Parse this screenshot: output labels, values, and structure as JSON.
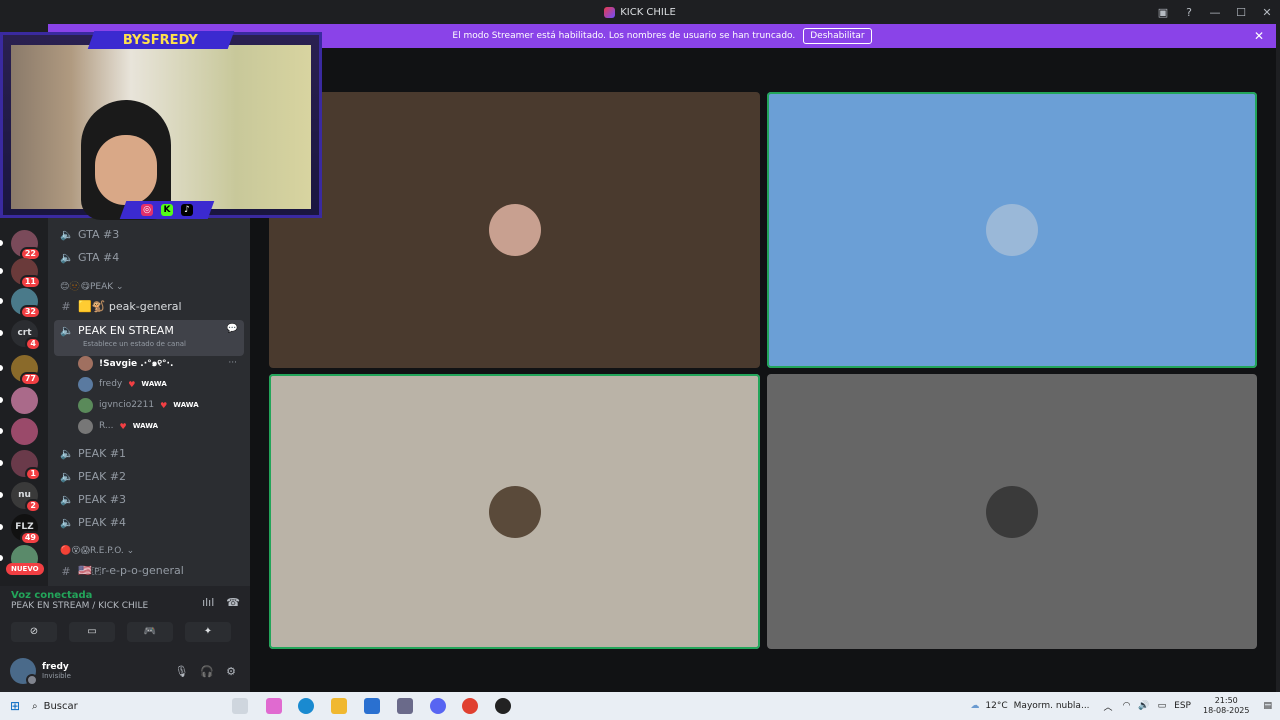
{
  "window": {
    "title": "KICK CHILE",
    "controls": [
      "inbox-icon",
      "help-icon",
      "minimize-icon",
      "maximize-icon",
      "close-icon"
    ]
  },
  "banner": {
    "text": "El modo Streamer está habilitado. Los nombres de usuario se han truncado.",
    "button": "Deshabilitar"
  },
  "overlay": {
    "name": "BYSFREDY",
    "socials": [
      "instagram-icon",
      "kick-icon",
      "tiktok-icon"
    ],
    "social_labels": [
      "◎",
      "K",
      "♪"
    ]
  },
  "servers": [
    {
      "badge": "22",
      "color": "#7a4a5a"
    },
    {
      "badge": "11",
      "color": "#6a3a3a"
    },
    {
      "badge": "32",
      "color": "#4a7a8a"
    },
    {
      "badge": "4",
      "label": "crt",
      "color": "#2b2d31"
    },
    {
      "badge": "77",
      "color": "#8a6a2a"
    },
    {
      "badge": "",
      "color": "#aa6a8a"
    },
    {
      "badge": "",
      "color": "#9a4a6a"
    },
    {
      "badge": "1",
      "color": "#6a3a4a"
    },
    {
      "badge": "2",
      "label": "nu",
      "color": "#3a3a3a"
    },
    {
      "badge": "49",
      "label": "FLZ",
      "color": "#111"
    },
    {
      "badge": "",
      "color": "#5a8a6a"
    }
  ],
  "new_badge": "NUEVO",
  "channels": {
    "top": [
      "GTA #3",
      "GTA #4"
    ],
    "cat_peak": "😊🫥😋PEAK",
    "peak_general": "🟨🐒 peak-general",
    "active": {
      "name": "PEAK EN STREAM",
      "status": "Establece un estado de canal"
    },
    "voice_users": [
      {
        "name": "!Savgie .·°๑୧°·.",
        "tag": "",
        "color": "#a07060"
      },
      {
        "name": "fredy",
        "tag": "WAWA",
        "color": "#5a7aa0"
      },
      {
        "name": "igvncio2211",
        "tag": "WAWA",
        "color": "#5a8a5a"
      },
      {
        "name": "R...",
        "tag": "WAWA",
        "color": "#777"
      }
    ],
    "peak_voice": [
      "PEAK #1",
      "PEAK #2",
      "PEAK #3",
      "PEAK #4"
    ],
    "cat_repo": "🔴😵😱R.E.P.O.",
    "repo_general": "🇺🇸🇵r-e-p-o-general"
  },
  "voice_panel": {
    "status": "Voz conectada",
    "location": "PEAK EN STREAM / KICK CHILE"
  },
  "user": {
    "name": "fredy",
    "status": "Invisible"
  },
  "tiles": [
    {
      "bg": "#4a3a2e",
      "avatar": "#c8a090",
      "speaking": false
    },
    {
      "bg": "#6b9fd6",
      "avatar": "#9ab8d8",
      "speaking": true
    },
    {
      "bg": "#bab3a7",
      "avatar": "#5a4a3a",
      "speaking": true
    },
    {
      "bg": "#666666",
      "avatar": "#3a3a3a",
      "speaking": false
    }
  ],
  "taskbar": {
    "search_label": "Buscar",
    "weather": "12°C",
    "weather_desc": "Mayorm. nubla...",
    "lang": "ESP",
    "time": "21:50",
    "date": "18-08-2025"
  }
}
